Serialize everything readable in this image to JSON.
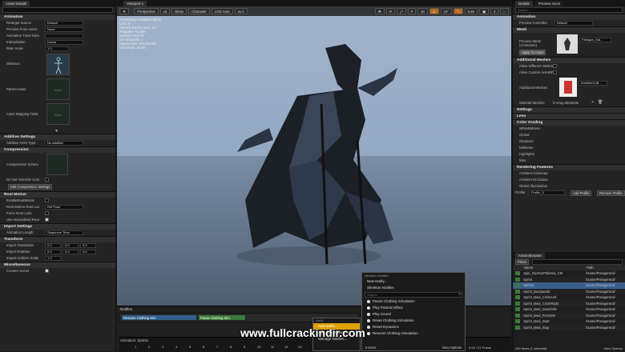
{
  "left_panel": {
    "tabs": [
      "Asset Details"
    ],
    "sections": {
      "animation": "Animation",
      "additive": "Additive Settings",
      "compression": "Compression",
      "root_motion": "Root Motion",
      "import": "Import Settings",
      "transform": "Transform",
      "misc": "Miscellaneous"
    },
    "rows": {
      "retarget_source": {
        "label": "Retarget Source",
        "value": "Default"
      },
      "preview_pose": {
        "label": "Preview Pose Asset",
        "value": "None"
      },
      "anim_track": {
        "label": "Animation Track Nam"
      },
      "interpolation": {
        "label": "Interpolation",
        "value": "Linear"
      },
      "rate_scale": {
        "label": "Rate Scale",
        "value": "1.0"
      },
      "skeleton": {
        "label": "Skeleton"
      },
      "parent_asset": {
        "label": "Parent Asset",
        "thumb": "None"
      },
      "asset_mapping": {
        "label": "Asset Mapping Table",
        "thumb": "None"
      },
      "additive_type": {
        "label": "Additive Anim Type",
        "value": "No additive"
      },
      "compression_scheme": {
        "label": "Compression Schem"
      },
      "no_override": {
        "label": "Do Not Override Com"
      },
      "edit_compression": "Edit Compression Settings",
      "enable_root": {
        "label": "EnableRootMotion"
      },
      "root_lock": {
        "label": "Root Motion Root Loc",
        "value": "Ref Pose"
      },
      "force_root": {
        "label": "Force Root Lock"
      },
      "normalized_root": {
        "label": "Use Normalized Root"
      },
      "anim_length": {
        "label": "Animation Length",
        "value": "Sequence Time"
      },
      "import_translation": {
        "label": "Import Translation",
        "x": "0.0",
        "y": "0.0",
        "z": "0.0"
      },
      "import_rotation": {
        "label": "Import Rotation",
        "x": "0.0",
        "y": "0.0",
        "z": "0.0"
      },
      "import_scale": {
        "label": "Import Uniform Scale",
        "value": "1.0"
      },
      "convert_scene": {
        "label": "Convert Scene"
      }
    }
  },
  "viewport": {
    "tab": "Viewport 1",
    "toolbar": {
      "perspective": "Perspective",
      "lit": "Lit",
      "show": "Show",
      "character": "Character",
      "lod": "LOD Auto",
      "speed": "x1.0",
      "num10": "10",
      "num10b": "10°",
      "num025": "0.25",
      "num4": "4"
    },
    "stats": [
      "Previewing Animation Sprint",
      "LOD: 0",
      "Current Screen Size: 1.0",
      "Triangles: 81,450",
      "Vertices: 50,778",
      "UV Channels: 1",
      "Approx Size: 87x40x195",
      "Framerate: 24.84"
    ],
    "notifies_label": "Notifies",
    "tracks": [
      "Resume Clothing Sim",
      "Pause Clothing Sim"
    ],
    "timeline": {
      "label": "Animation: Sprint1",
      "frame": "0.00 / 21 Frame",
      "ticks": [
        "1",
        "2",
        "3",
        "4",
        "5",
        "6",
        "7",
        "8",
        "9",
        "10",
        "11",
        "12",
        "13"
      ]
    }
  },
  "context_menu": {
    "header": "Skeleton Notifies",
    "items": [
      "New Notify...",
      "Skeleton Notifies"
    ],
    "search_placeholder": "Search",
    "options": [
      "Pause Clothing Simulation",
      "Play Particle Effect",
      "Play Sound",
      "Reset Clothing Simulation",
      "Reset Dynamics",
      "Resume Clothing Simulation"
    ],
    "count": "6 items",
    "view_options": "View Options"
  },
  "submenu": {
    "items": [
      "Notify",
      "Add Notify...",
      "Add Sync Marker...",
      "Manage Notifies..."
    ]
  },
  "watermark": "www.fullcrackindir.com",
  "right_panel": {
    "tabs": [
      "Details",
      "Preview Scen"
    ],
    "search_placeholder": "Search",
    "sections": {
      "animation": "Animation",
      "mesh": "Mesh",
      "additional": "Additional Meshes",
      "settings": "Settings",
      "lens": "Lens",
      "color": "Color Grading",
      "rendering": "Rendering Features"
    },
    "preview_controller": {
      "label": "Preview Controller",
      "value": "Default"
    },
    "preview_mesh": {
      "label": "Preview Mesh (Animation)",
      "value": "Paragon_Kal..."
    },
    "apply_btn": "Apply To Asset",
    "allow_diff": "Allow Different Skeleton",
    "allow_custom": "Allow Custom AnimBP...",
    "additional_meshes": "Additional Meshes",
    "mesh_value": "InvisibleColli...",
    "skeletal_meshes": {
      "label": "Skeletal Meshes",
      "value": "0 Array elements"
    },
    "color_items": [
      "WhiteBalance",
      "Global",
      "Shadows",
      "Midtones",
      "Highlights",
      "Misc"
    ],
    "render_items": [
      "Ambient Cubemap",
      "Ambient Occlusion",
      "Global Illumination"
    ],
    "profile": {
      "label": "Profile",
      "value": "Profile_0",
      "add": "Add Profile",
      "remove": "Remove Profile"
    }
  },
  "asset_browser": {
    "tab": "Asset Browser",
    "filters": "Filters",
    "cols": [
      "Name",
      "Path"
    ],
    "rows": [
      {
        "name": "Spin_ImpFastTolleted_CM",
        "path": "/Game/ParagonKal/"
      },
      {
        "name": "Sprint",
        "path": "/Game/ParagonKal/"
      },
      {
        "name": "Sprint1",
        "path": "/Game/ParagonKal/"
      },
      {
        "name": "Sprint_Backpedal",
        "path": "/Game/ParagonKal/"
      },
      {
        "name": "Sprint_Bwd_CircleLeft",
        "path": "/Game/ParagonKal/"
      },
      {
        "name": "Sprint_Bwd_CircleRight",
        "path": "/Game/ParagonKal/"
      },
      {
        "name": "Sprint_Bwd_Downhill2",
        "path": "/Game/ParagonKal/"
      },
      {
        "name": "Sprint_Bwd_Pivot180",
        "path": "/Game/ParagonKal/"
      },
      {
        "name": "Sprint_Bwd_Start",
        "path": "/Game/ParagonKal/"
      },
      {
        "name": "Sprint_Bwd_Stop",
        "path": "/Game/ParagonKal/"
      }
    ],
    "count": "200 items (1 selected)",
    "view_options": "View Options"
  },
  "colors": {
    "accent": "#e0a000",
    "select": "#3a5f8f",
    "track_blue": "#2f5f8a",
    "track_green": "#3a7a3a"
  }
}
